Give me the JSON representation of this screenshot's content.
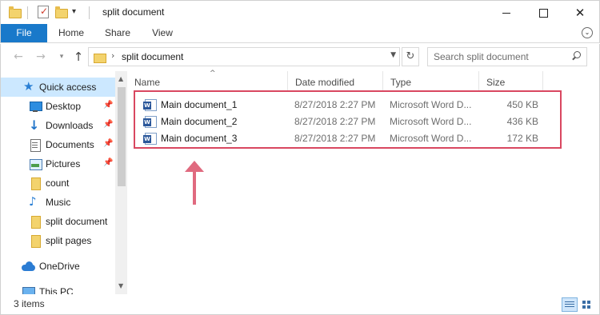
{
  "window": {
    "title": "split document"
  },
  "ribbon": {
    "tabs": [
      "File",
      "Home",
      "Share",
      "View"
    ]
  },
  "address": {
    "path": "split document",
    "search_placeholder": "Search split document"
  },
  "navpane": {
    "items": [
      {
        "label": "Quick access",
        "icon": "star-icon",
        "pinned": false
      },
      {
        "label": "Desktop",
        "icon": "desktop-icon",
        "pinned": true
      },
      {
        "label": "Downloads",
        "icon": "download-icon",
        "pinned": true
      },
      {
        "label": "Documents",
        "icon": "documents-icon",
        "pinned": true
      },
      {
        "label": "Pictures",
        "icon": "pictures-icon",
        "pinned": true
      },
      {
        "label": "count",
        "icon": "folder-icon",
        "pinned": false
      },
      {
        "label": "Music",
        "icon": "music-icon",
        "pinned": false
      },
      {
        "label": "split document",
        "icon": "folder-icon",
        "pinned": false
      },
      {
        "label": "split pages",
        "icon": "folder-icon",
        "pinned": false
      },
      {
        "label": "OneDrive",
        "icon": "onedrive-icon",
        "pinned": false
      },
      {
        "label": "This PC",
        "icon": "this-pc-icon",
        "pinned": false
      }
    ]
  },
  "columns": [
    "Name",
    "Date modified",
    "Type",
    "Size"
  ],
  "files": [
    {
      "name": "Main document_1",
      "date": "8/27/2018 2:27 PM",
      "type": "Microsoft Word D...",
      "size": "450 KB"
    },
    {
      "name": "Main document_2",
      "date": "8/27/2018 2:27 PM",
      "type": "Microsoft Word D...",
      "size": "436 KB"
    },
    {
      "name": "Main document_3",
      "date": "8/27/2018 2:27 PM",
      "type": "Microsoft Word D...",
      "size": "172 KB"
    }
  ],
  "status": {
    "item_count": "3 items"
  },
  "colors": {
    "file_tab": "#1979ca",
    "highlight_box": "#d94760",
    "annotation_arrow": "#e06a7f",
    "selected_nav": "#cce8ff"
  }
}
